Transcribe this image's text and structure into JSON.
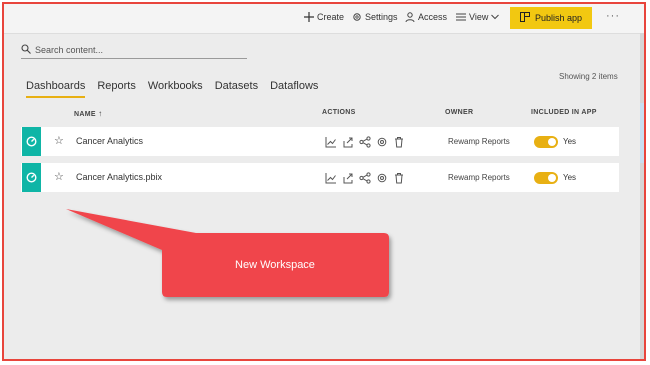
{
  "toolbar": {
    "create_label": "Create",
    "settings_label": "Settings",
    "access_label": "Access",
    "view_label": "View",
    "publish_label": "Publish app",
    "more_label": "···"
  },
  "search": {
    "placeholder": "Search content..."
  },
  "tabs": [
    {
      "label": "Dashboards",
      "active": true
    },
    {
      "label": "Reports"
    },
    {
      "label": "Workbooks"
    },
    {
      "label": "Datasets"
    },
    {
      "label": "Dataflows"
    }
  ],
  "showing_text": "Showing 2 items",
  "columns": {
    "name": "NAME",
    "sort_glyph": "↑",
    "actions": "ACTIONS",
    "owner": "OWNER",
    "included": "INCLUDED IN APP"
  },
  "rows": [
    {
      "name": "Cancer Analytics",
      "owner": "Rewamp Reports",
      "included": "Yes",
      "star": "☆"
    },
    {
      "name": "Cancer Analytics.pbix",
      "owner": "Rewamp Reports",
      "included": "Yes",
      "star": "☆"
    }
  ],
  "callout": {
    "text": "New Workspace",
    "color": "#f0444b"
  },
  "colors": {
    "accent": "#f2c811",
    "toggle": "#e8b013",
    "badge": "#0fb5a6",
    "frame": "#e8453c"
  }
}
